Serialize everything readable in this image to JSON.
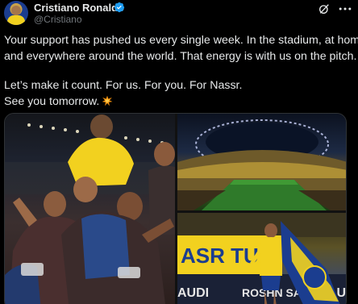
{
  "author": {
    "name": "Cristiano Ronaldo",
    "handle": "@Cristiano",
    "verified": true,
    "avatar_icon": "avatar-photo"
  },
  "actions": {
    "grok_icon": "grok-icon",
    "more_icon": "more-options-icon"
  },
  "tweet": {
    "line1": "Your support has pushed us every single week. In the stadium, at home",
    "line2": "and everywhere around the world. That energy is with us on the pitch.",
    "line3": "Let’s make it count. For us. For you. For Nassr.",
    "line4": "See you tomorrow.",
    "line4_emoji": "collision-emoji"
  },
  "media": {
    "photos": [
      "team-celebration-photo",
      "stadium-photo",
      "player-with-flag-photo"
    ],
    "signage": {
      "left_board": "ASR TU",
      "bottom_left": "AUDI",
      "bottom_mid": "ROSHN SAUDI",
      "bottom_right": "AUDI"
    }
  },
  "colors": {
    "background": "#000000",
    "text": "#e7e9ea",
    "muted": "#71767b",
    "verified": "#1d9bf0",
    "kit_yellow": "#f2d11f",
    "kit_blue": "#1b3d8f"
  }
}
